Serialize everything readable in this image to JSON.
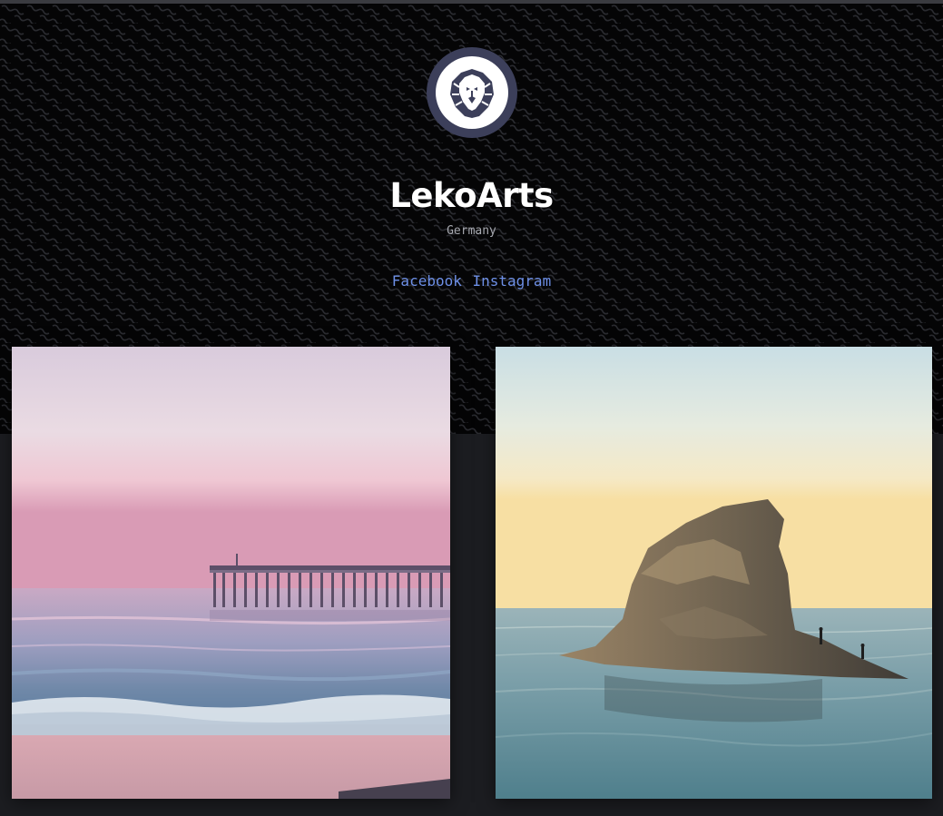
{
  "profile": {
    "name": "LekoArts",
    "location": "Germany",
    "avatar_icon": "lion-logo-icon"
  },
  "social": {
    "facebook": "Facebook",
    "instagram": "Instagram"
  },
  "gallery": [
    {
      "subject": "pier-at-pink-sunset-photo"
    },
    {
      "subject": "sea-rock-at-dawn-photo"
    }
  ],
  "colors": {
    "hero_background": "#050506",
    "page_background": "#1c1d21",
    "link": "#6d8fe6",
    "avatar_ring": "#3c3f5a"
  }
}
